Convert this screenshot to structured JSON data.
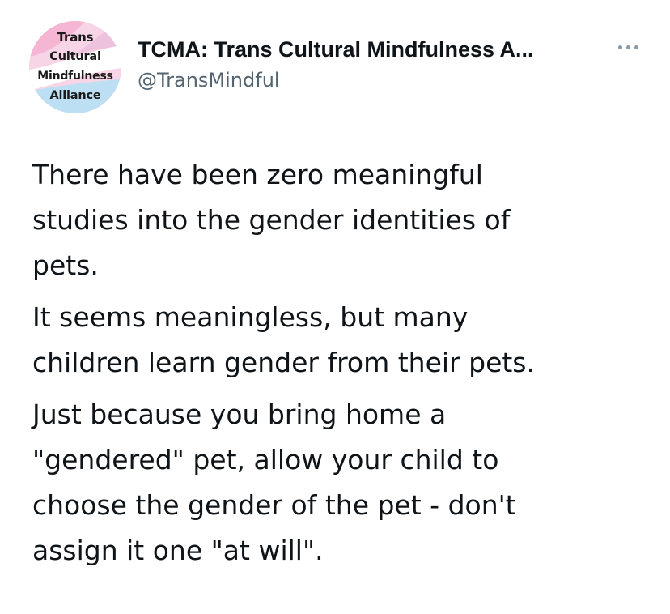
{
  "author": {
    "display_name": "TCMA: Trans Cultural Mindfulness A...",
    "handle": "@TransMindful",
    "avatar_text": [
      "Trans",
      "Cultural",
      "Mindfulness",
      "Alliance"
    ],
    "avatar_colors": [
      "#f4b6d2",
      "#a9d7f2",
      "#ffffff"
    ]
  },
  "more_icon": "more-horizontal-icon",
  "tweet": {
    "paragraphs": [
      "There have been zero meaningful\nstudies into the gender identities of\npets.",
      "It seems meaningless, but many\nchildren learn gender from their pets.",
      "Just because you bring home a\n\"gendered\" pet, allow your child to\nchoose the gender of the pet - don't\nassign it one \"at will\"."
    ]
  }
}
